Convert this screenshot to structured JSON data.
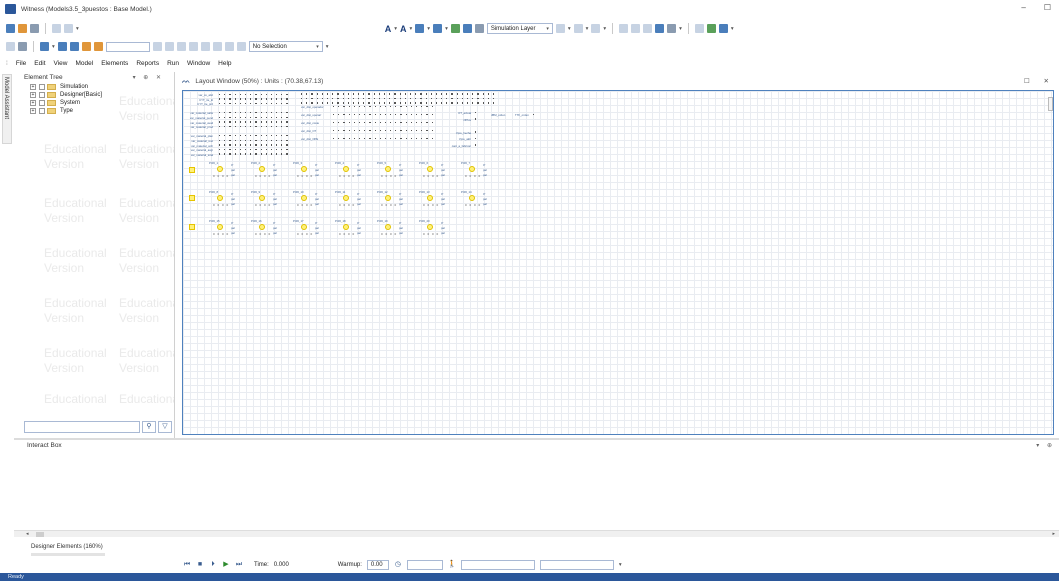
{
  "window": {
    "title": "Witness (Models3.5_3puestos : Base Model.)",
    "controls": [
      "–",
      "☐"
    ]
  },
  "toolbar": {
    "layer_combo": "Simulation Layer",
    "selection_combo": "No Selection"
  },
  "menu": [
    "File",
    "Edit",
    "View",
    "Model",
    "Elements",
    "Reports",
    "Run",
    "Window",
    "Help"
  ],
  "side_tab": {
    "label": "Model Assistant"
  },
  "element_tree": {
    "title": "Element Tree",
    "controls": "▾ ⊕ ✕",
    "items": [
      "Simulation",
      "Designer[Basic]",
      "System",
      "Type"
    ],
    "watermark": [
      "Educational",
      "Version"
    ]
  },
  "layout_window": {
    "title": "Layout Window (50%) : Units : (70.38,67.13)",
    "controls": "☐ ✕"
  },
  "model": {
    "left_labels": [
      "var_co_aitd",
      "CYT_ite_tit",
      "CYT_ite_prd",
      "",
      "var_material_salts",
      "var_material_pend",
      "var_material_avail",
      "var_material_prod",
      "",
      "var_material_plan",
      "var_material_rest",
      "var_material_ordr",
      "var_material_avgt",
      "var_material_total"
    ],
    "mid_labels": [
      "var_dist_operador",
      "var_dist_uperarr",
      "var_dist_coste",
      "var_dist_OT",
      "var_dist_OPE"
    ],
    "right_labels": [
      "OT_actual",
      "OPlus",
      "",
      "Vpre_hecha",
      "Vpre_aktr",
      "cant_a_fabricar"
    ],
    "far_labels": [
      "JBM_orden",
      "TTF_orden"
    ],
    "station_rows": [
      [
        "Pr06_1",
        "Pr06_2",
        "Pr06_3",
        "Pr06_4",
        "Pr06_5",
        "Pr06_6",
        "Pr06_7"
      ],
      [
        "Pr06_8",
        "Pr06_9",
        "Pr06_10",
        "Pr06_11",
        "Pr06_12",
        "Pr06_13",
        "Pr06_14"
      ],
      [
        "Pr06_15",
        "Pr06_16",
        "Pr06_17",
        "Pr06_18",
        "Pr06_19",
        "Pr06_20"
      ]
    ],
    "station_side": [
      "0ˆ",
      "pal",
      "pal"
    ],
    "station_dots": "0 0 0 0"
  },
  "interact_box": {
    "title": "Interact Box",
    "controls": "▾ ⊕"
  },
  "designer": {
    "title": "Designer Elements (160%)"
  },
  "run": {
    "time_label": "Time:",
    "time_value": "0.000",
    "warmup_label": "Warmup:",
    "warmup_value": "0.00"
  },
  "status": {
    "text": "Ready"
  }
}
